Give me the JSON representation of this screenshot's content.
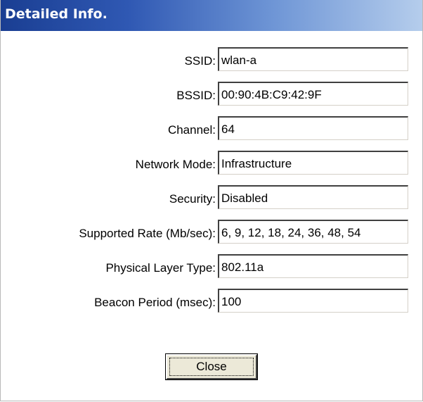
{
  "window": {
    "title": "Detailed Info."
  },
  "fields": [
    {
      "label": "SSID:",
      "value": "wlan-a"
    },
    {
      "label": "BSSID:",
      "value": "00:90:4B:C9:42:9F"
    },
    {
      "label": "Channel:",
      "value": "64"
    },
    {
      "label": "Network Mode:",
      "value": "Infrastructure"
    },
    {
      "label": "Security:",
      "value": "Disabled"
    },
    {
      "label": "Supported Rate (Mb/sec):",
      "value": "6, 9, 12, 18, 24, 36, 48, 54"
    },
    {
      "label": "Physical Layer Type:",
      "value": "802.11a"
    },
    {
      "label": "Beacon Period (msec):",
      "value": "100"
    }
  ],
  "actions": {
    "close_label": "Close"
  },
  "colors": {
    "title_bar_start": "#1a3e92",
    "title_bar_end": "#b5cdec",
    "button_face": "#ece9d8"
  }
}
